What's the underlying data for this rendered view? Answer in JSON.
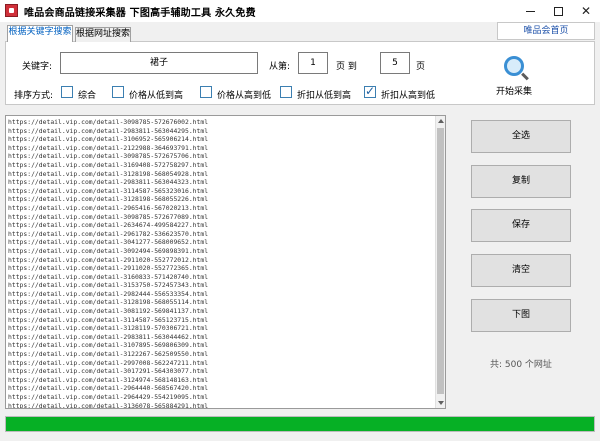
{
  "window": {
    "title": "唯品会商品链接采集器   下图高手辅助工具   永久免费",
    "minimize_glyph": "minimize",
    "maximize_glyph": "maximize",
    "close_glyph": "✕"
  },
  "tabs": [
    {
      "label": "根据关键字搜索",
      "active": true
    },
    {
      "label": "根据网址搜索",
      "active": false
    }
  ],
  "home_link": "唯品会首页",
  "search": {
    "keyword_label": "关键字:",
    "keyword_value": "裙子",
    "from_label": "从第:",
    "from_value": "1",
    "page_to_label": "页 到",
    "to_value": "5",
    "page_label": "页",
    "start_label": "开始采集"
  },
  "sort": {
    "label": "排序方式:",
    "options": [
      {
        "label": "综合",
        "checked": false
      },
      {
        "label": "价格从低到高",
        "checked": false
      },
      {
        "label": "价格从高到低",
        "checked": false
      },
      {
        "label": "折扣从低到高",
        "checked": false
      },
      {
        "label": "折扣从高到低",
        "checked": true
      }
    ]
  },
  "urls": [
    "https://detail.vip.com/detail-3098785-572676002.html",
    "https://detail.vip.com/detail-2983811-563044295.html",
    "https://detail.vip.com/detail-3106952-565906214.html",
    "https://detail.vip.com/detail-2122988-364693791.html",
    "https://detail.vip.com/detail-3098785-572675706.html",
    "https://detail.vip.com/detail-3169408-572758297.html",
    "https://detail.vip.com/detail-3128198-568054928.html",
    "https://detail.vip.com/detail-2983811-563044323.html",
    "https://detail.vip.com/detail-3114587-565323016.html",
    "https://detail.vip.com/detail-3128198-568055226.html",
    "https://detail.vip.com/detail-2965416-567020213.html",
    "https://detail.vip.com/detail-3098785-572677089.html",
    "https://detail.vip.com/detail-2634674-499584227.html",
    "https://detail.vip.com/detail-2961782-536623570.html",
    "https://detail.vip.com/detail-3041277-568009652.html",
    "https://detail.vip.com/detail-3092494-569898391.html",
    "https://detail.vip.com/detail-2911020-552772012.html",
    "https://detail.vip.com/detail-2911020-552772365.html",
    "https://detail.vip.com/detail-3160833-571420740.html",
    "https://detail.vip.com/detail-3153750-572457343.html",
    "https://detail.vip.com/detail-2982444-556533354.html",
    "https://detail.vip.com/detail-3128198-568055114.html",
    "https://detail.vip.com/detail-3081192-569841137.html",
    "https://detail.vip.com/detail-3114587-565123715.html",
    "https://detail.vip.com/detail-3128119-570306721.html",
    "https://detail.vip.com/detail-2983811-563044462.html",
    "https://detail.vip.com/detail-3107895-569806309.html",
    "https://detail.vip.com/detail-3122267-562509550.html",
    "https://detail.vip.com/detail-2997008-562247211.html",
    "https://detail.vip.com/detail-3017291-564303077.html",
    "https://detail.vip.com/detail-3124974-568148163.html",
    "https://detail.vip.com/detail-2964440-568567420.html",
    "https://detail.vip.com/detail-2964429-554219095.html",
    "https://detail.vip.com/detail-3136078-565884291.html"
  ],
  "buttons": {
    "select_all": "全选",
    "copy": "复制",
    "save": "保存",
    "clear": "清空",
    "download": "下图"
  },
  "count_text": "共: 500 个网址",
  "progress": {
    "fraction": 1.0,
    "color": "#06b025"
  }
}
